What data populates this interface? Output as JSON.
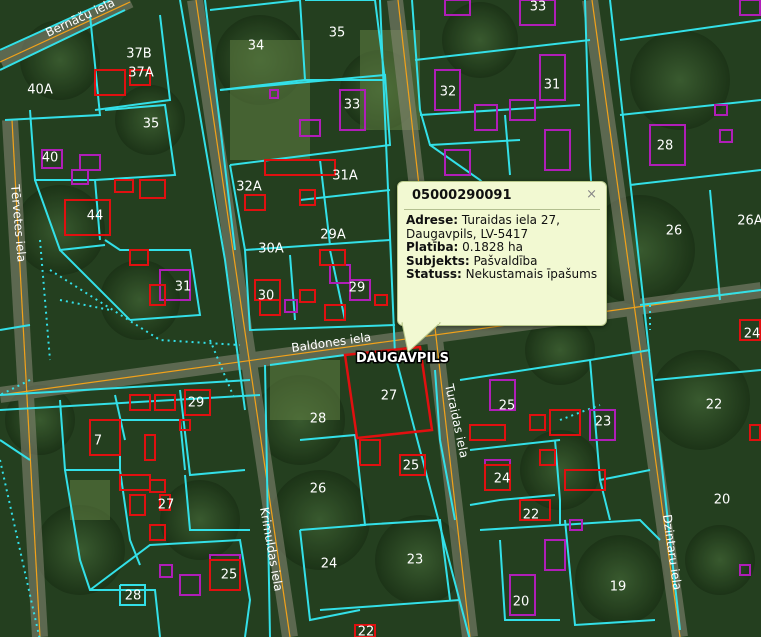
{
  "popup": {
    "title": "05000290091",
    "close": "×",
    "rows": [
      {
        "label": "Adrese:",
        "value": "Turaidas iela 27, Daugavpils, LV-5417"
      },
      {
        "label": "Platība:",
        "value": "0.1828 ha"
      },
      {
        "label": "Subjekts:",
        "value": "Pašvaldība"
      },
      {
        "label": "Statuss:",
        "value": "Nekustamais īpašums"
      }
    ]
  },
  "map": {
    "city_label": "DAUGAVPILS",
    "streets": [
      {
        "name": "Bernāču iela"
      },
      {
        "name": "Tērvetes iela"
      },
      {
        "name": "Baldones iela"
      },
      {
        "name": "Turaidas iela"
      },
      {
        "name": "Krimuldas iela"
      },
      {
        "name": "Dzintaru iela"
      }
    ],
    "parcels": [
      "37B",
      "37A",
      "40A",
      "35",
      "34",
      "35",
      "33",
      "33",
      "32",
      "31",
      "40",
      "44",
      "32A",
      "31A",
      "30A",
      "29A",
      "31",
      "30",
      "29",
      "28",
      "26",
      "26A",
      "24",
      "27",
      "28",
      "29",
      "7",
      "25",
      "23",
      "22",
      "26",
      "25",
      "24",
      "22",
      "20",
      "27",
      "24",
      "23",
      "19",
      "25",
      "28",
      "22",
      "20"
    ],
    "colors": {
      "boundary": "#33e0e8",
      "highlight": "#e01010",
      "building": "#b01eb8",
      "road": "#f2a21a"
    }
  }
}
